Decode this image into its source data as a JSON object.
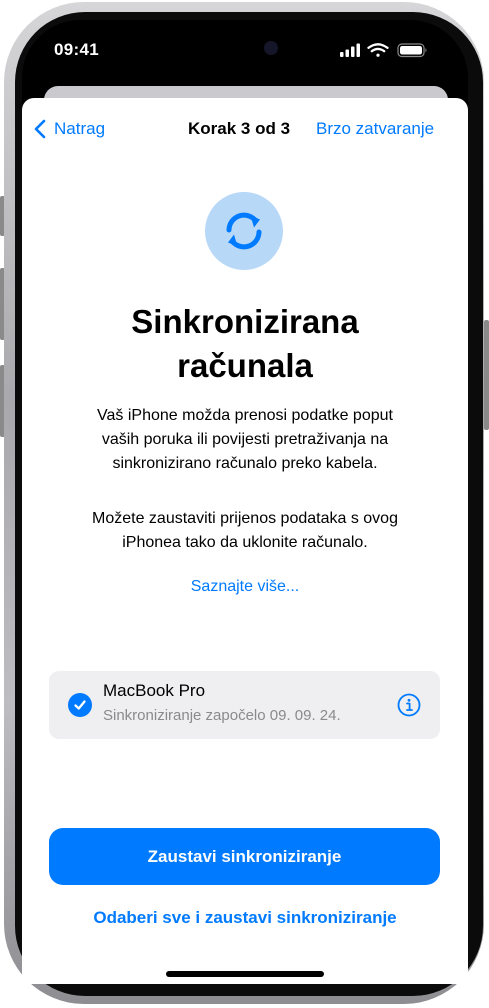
{
  "status_bar": {
    "time": "09:41",
    "icons": [
      "cellular-signal-icon",
      "wifi-icon",
      "battery-icon"
    ]
  },
  "nav": {
    "back_label": "Natrag",
    "step_label": "Korak 3 od 3",
    "quick_exit_label": "Brzo zatvaranje"
  },
  "hero": {
    "icon": "sync-icon",
    "title": "Sinkronizirana\nračunala"
  },
  "body": {
    "paragraph1": "Vaš iPhone možda prenosi podatke poput\nvaših poruka ili povijesti pretraživanja na\nsinkronizirano računalo preko kabela.",
    "paragraph2": "Možete zaustaviti prijenos podataka s ovog\niPhonea tako da uklonite računalo.",
    "learn_more": "Saznajte više..."
  },
  "device": {
    "name": "MacBook Pro",
    "status": "Sinkroniziranje započelo 09. 09. 24.",
    "selected": true
  },
  "actions": {
    "primary": "Zaustavi sinkroniziranje",
    "secondary": "Odaberi sve i zaustavi sinkroniziranje"
  },
  "colors": {
    "accent": "#007aff",
    "badge_bg": "#b8d8f8",
    "card_bg": "#efeff1"
  }
}
